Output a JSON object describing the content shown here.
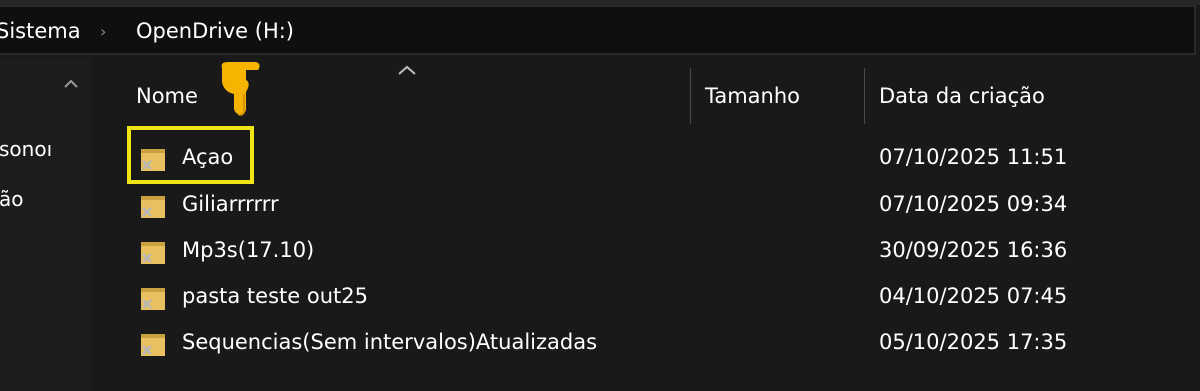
{
  "breadcrumb": {
    "items": [
      "Sistema",
      "OpenDrive (H:)"
    ],
    "separator": "›"
  },
  "navpane": {
    "items": [
      "sonoı",
      "ão"
    ]
  },
  "columns": {
    "name": "Nome",
    "size": "Tamanho",
    "created": "Data da criação",
    "sort_column": "Nome",
    "sort_direction": "ascending"
  },
  "files": [
    {
      "name": "Açao",
      "size": "",
      "created": "07/10/2025 11:51",
      "type": "folder",
      "status": "offline"
    },
    {
      "name": "Giliarrrrrr",
      "size": "",
      "created": "07/10/2025 09:34",
      "type": "folder",
      "status": "offline"
    },
    {
      "name": "Mp3s(17.10)",
      "size": "",
      "created": "30/09/2025 16:36",
      "type": "folder",
      "status": "offline"
    },
    {
      "name": "pasta teste out25",
      "size": "",
      "created": "04/10/2025 07:45",
      "type": "folder",
      "status": "offline"
    },
    {
      "name": "Sequencias(Sem intervalos)Atualizadas",
      "size": "",
      "created": "05/10/2025 17:35",
      "type": "folder",
      "status": "offline"
    }
  ],
  "annotations": {
    "highlighted_item": "Açao",
    "highlight_color": "#f1e415",
    "pointer_icon": "pointing-hand-emoji"
  },
  "colors": {
    "background": "#191919",
    "address_bar": "#0f0f0f",
    "folder": "#e8c060",
    "status_x": "#b8b8b8"
  }
}
